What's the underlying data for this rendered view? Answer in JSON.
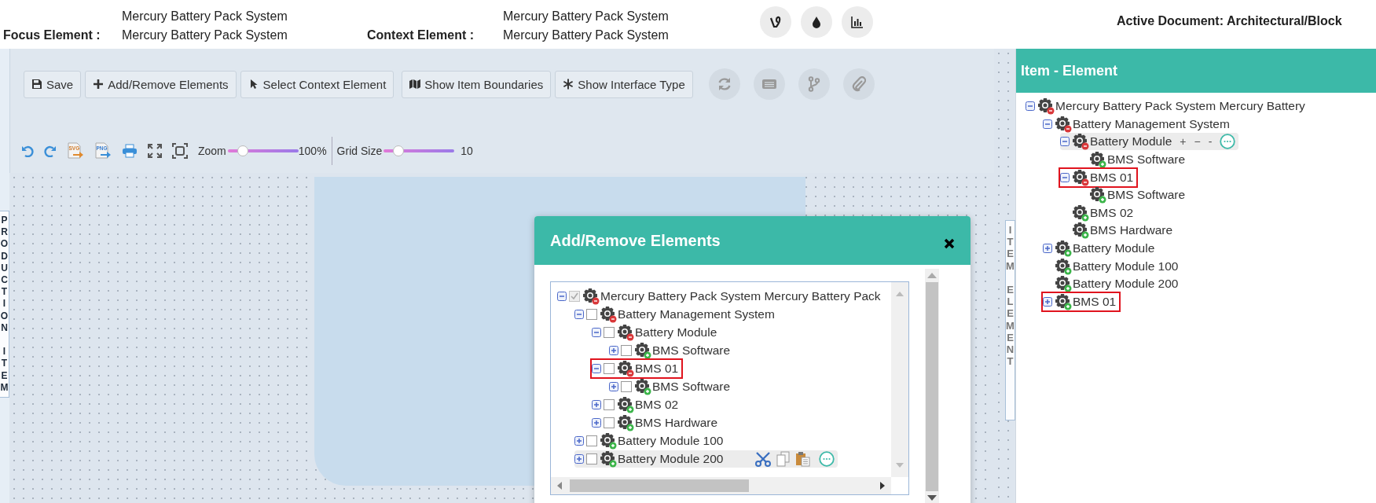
{
  "header": {
    "focus_label": "Focus Element :",
    "focus_values": [
      "Mercury Battery Pack System",
      "Mercury Battery Pack System"
    ],
    "context_label": "Context Element :",
    "context_values": [
      "Mercury Battery Pack System",
      "Mercury Battery Pack System"
    ],
    "active_document": "Active Document: Architectural/Block"
  },
  "toolbar": {
    "buttons": [
      {
        "label": "Save",
        "kind": "save"
      },
      {
        "label": "Add/Remove Elements",
        "kind": "plus"
      },
      {
        "label": "Select Context Element",
        "kind": "pointer"
      },
      {
        "label": "Show Item Boundaries",
        "kind": "map"
      },
      {
        "label": "Show Interface Type",
        "kind": "snowflake"
      }
    ],
    "export_labels": [
      "SVG",
      "PNG"
    ],
    "zoom": {
      "label": "Zoom",
      "level": 0.2,
      "reading": "100%"
    },
    "grid": {
      "label": "Grid Size",
      "level": 0.2,
      "reading": "10"
    }
  },
  "left_tab": "PRODUCTION ITEM",
  "right_tab": "ITEM ELEMENT",
  "item_panel": {
    "title": "Item - Element",
    "tree": [
      {
        "label": "Mercury Battery Pack System Mercury Battery",
        "kind": "remove",
        "expandable": true,
        "expanded": true,
        "outlined": false,
        "hovered": false,
        "children": [
          {
            "label": "Battery Management System",
            "kind": "remove",
            "expandable": true,
            "expanded": true,
            "outlined": false,
            "hovered": false,
            "children": [
              {
                "label": "Battery Module",
                "kind": "remove",
                "expandable": true,
                "expanded": true,
                "outlined": false,
                "hovered": true,
                "actions": [
                  "+",
                  "−",
                  "-"
                ],
                "children": [
                  {
                    "label": "BMS Software",
                    "kind": "add",
                    "expandable": false,
                    "outlined": false,
                    "hovered": false
                  }
                ]
              },
              {
                "label": "BMS 01",
                "kind": "remove",
                "expandable": true,
                "expanded": true,
                "outlined": true,
                "hovered": false,
                "children": [
                  {
                    "label": "BMS Software",
                    "kind": "add",
                    "expandable": false,
                    "outlined": false,
                    "hovered": false
                  }
                ]
              },
              {
                "label": "BMS 02",
                "kind": "add",
                "expandable": false,
                "outlined": false,
                "hovered": false
              },
              {
                "label": "BMS Hardware",
                "kind": "add",
                "expandable": false,
                "outlined": false,
                "hovered": false
              }
            ]
          },
          {
            "label": "Battery Module",
            "kind": "add",
            "expandable": true,
            "expanded": false,
            "outlined": false,
            "hovered": false
          },
          {
            "label": "Battery Module 100",
            "kind": "add",
            "expandable": false,
            "outlined": false,
            "hovered": false
          },
          {
            "label": "Battery Module 200",
            "kind": "add",
            "expandable": false,
            "outlined": false,
            "hovered": false
          },
          {
            "label": "BMS 01",
            "kind": "add",
            "expandable": true,
            "expanded": false,
            "outlined": true,
            "hovered": false
          }
        ]
      }
    ]
  },
  "dialog": {
    "title": "Add/Remove Elements",
    "tree": [
      {
        "label": "Mercury Battery Pack System Mercury Battery Pack",
        "kind": "remove",
        "expandable": true,
        "expanded": true,
        "checked": true,
        "disabled": true,
        "outlined": false,
        "hovered": false,
        "children": [
          {
            "label": "Battery Management System",
            "kind": "remove",
            "expandable": true,
            "expanded": true,
            "checked": false,
            "disabled": false,
            "outlined": false,
            "hovered": false,
            "children": [
              {
                "label": "Battery Module",
                "kind": "remove",
                "expandable": true,
                "expanded": true,
                "checked": false,
                "disabled": false,
                "outlined": false,
                "hovered": false,
                "children": [
                  {
                    "label": "BMS Software",
                    "kind": "add",
                    "expandable": true,
                    "expanded": false,
                    "checked": false,
                    "disabled": false,
                    "outlined": false,
                    "hovered": false
                  }
                ]
              },
              {
                "label": "BMS 01",
                "kind": "remove",
                "expandable": true,
                "expanded": true,
                "checked": false,
                "disabled": false,
                "outlined": true,
                "hovered": false,
                "children": [
                  {
                    "label": "BMS Software",
                    "kind": "add",
                    "expandable": true,
                    "expanded": false,
                    "checked": false,
                    "disabled": false,
                    "outlined": false,
                    "hovered": false
                  }
                ]
              },
              {
                "label": "BMS 02",
                "kind": "add",
                "expandable": true,
                "expanded": false,
                "checked": false,
                "disabled": false,
                "outlined": false,
                "hovered": false
              },
              {
                "label": "BMS Hardware",
                "kind": "add",
                "expandable": true,
                "expanded": false,
                "checked": false,
                "disabled": false,
                "outlined": false,
                "hovered": false
              }
            ]
          },
          {
            "label": "Battery Module 100",
            "kind": "add",
            "expandable": true,
            "expanded": false,
            "checked": false,
            "disabled": false,
            "outlined": false,
            "hovered": false
          },
          {
            "label": "Battery Module 200",
            "kind": "add",
            "expandable": true,
            "expanded": false,
            "checked": false,
            "disabled": false,
            "outlined": false,
            "hovered": true
          }
        ]
      }
    ]
  }
}
